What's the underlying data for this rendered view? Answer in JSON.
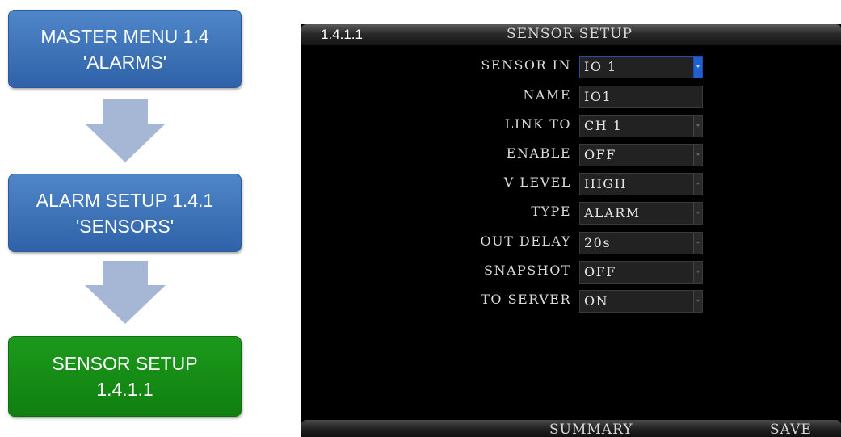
{
  "flow": [
    {
      "line1": "MASTER MENU 1.4",
      "line2": "'ALARMS'"
    },
    {
      "line1": "ALARM SETUP 1.4.1",
      "line2": "'SENSORS'"
    },
    {
      "line1": "SENSOR SETUP",
      "line2": "1.4.1.1"
    }
  ],
  "colors": {
    "flow_blue": "#3b73ba",
    "flow_green": "#138c13",
    "arrow": "#a6b7d6",
    "screen_bg": "#000000",
    "active_border": "#2b4aa8"
  },
  "screen": {
    "breadcrumb": "1.4.1.1",
    "title": "SENSOR SETUP",
    "fields": [
      {
        "label": "SENSOR IN",
        "value": "IO 1"
      },
      {
        "label": "NAME",
        "value": "IO1"
      },
      {
        "label": "LINK TO",
        "value": "CH 1"
      },
      {
        "label": "ENABLE",
        "value": "OFF"
      },
      {
        "label": "V LEVEL",
        "value": "HIGH"
      },
      {
        "label": "TYPE",
        "value": "ALARM"
      },
      {
        "label": "OUT DELAY",
        "value": "20s"
      },
      {
        "label": "SNAPSHOT",
        "value": "OFF"
      },
      {
        "label": "TO SERVER",
        "value": "ON"
      }
    ],
    "footer": {
      "summary": "SUMMARY",
      "save": "SAVE"
    }
  }
}
